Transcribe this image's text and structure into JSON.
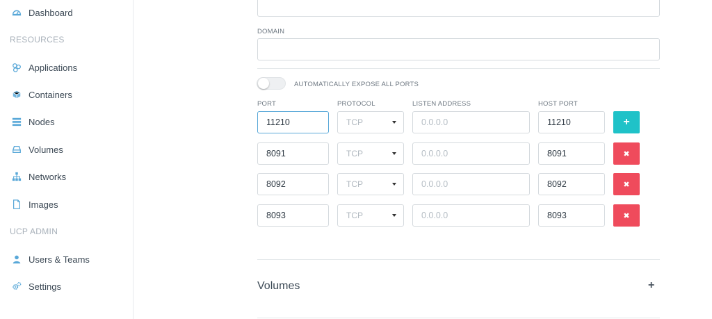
{
  "sidebar": {
    "dashboard": "Dashboard",
    "resources_label": "RESOURCES",
    "items": [
      {
        "label": "Applications"
      },
      {
        "label": "Containers"
      },
      {
        "label": "Nodes"
      },
      {
        "label": "Volumes"
      },
      {
        "label": "Networks"
      },
      {
        "label": "Images"
      }
    ],
    "admin_label": "UCP ADMIN",
    "admin_items": [
      {
        "label": "Users & Teams"
      },
      {
        "label": "Settings"
      }
    ]
  },
  "form": {
    "domain_label": "DOMAIN",
    "domain_value": "",
    "expose_label": "AUTOMATICALLY EXPOSE ALL PORTS",
    "port_header": "PORT",
    "protocol_header": "PROTOCOL",
    "listen_header": "LISTEN ADDRESS",
    "host_header": "HOST PORT",
    "rows": [
      {
        "port": "11210",
        "protocol": "TCP",
        "listen_placeholder": "0.0.0.0",
        "host_port": "11210",
        "action": "+"
      },
      {
        "port": "8091",
        "protocol": "TCP",
        "listen_placeholder": "0.0.0.0",
        "host_port": "8091",
        "action": "✖"
      },
      {
        "port": "8092",
        "protocol": "TCP",
        "listen_placeholder": "0.0.0.0",
        "host_port": "8092",
        "action": "✖"
      },
      {
        "port": "8093",
        "protocol": "TCP",
        "listen_placeholder": "0.0.0.0",
        "host_port": "8093",
        "action": "✖"
      }
    ]
  },
  "volumes": {
    "title": "Volumes",
    "expand": "+"
  },
  "colors": {
    "accent": "#1fc2c8",
    "danger": "#ef4b5c",
    "icon": "#59a8d8"
  }
}
